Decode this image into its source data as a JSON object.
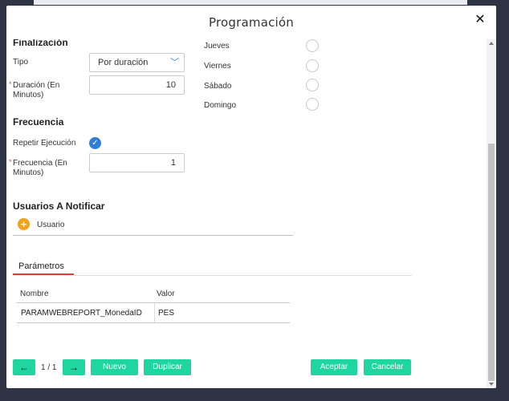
{
  "dialog": {
    "title": "Programación",
    "close_icon": "close-icon"
  },
  "finalizacion": {
    "section_title": "Finalización",
    "tipo_label": "Tipo",
    "tipo_value": "Por duración",
    "duracion_label_line1": "Duración (En",
    "duracion_label_line2": "Minutos)",
    "duracion_value": "10",
    "required_mark": "*"
  },
  "dias": [
    {
      "label": "Jueves"
    },
    {
      "label": "Viernes"
    },
    {
      "label": "Sábado"
    },
    {
      "label": "Domingo"
    }
  ],
  "frecuencia": {
    "section_title": "Frecuencia",
    "repetir_label": "Repetir Ejecución",
    "repetir_checked": true,
    "frecuencia_label_line1": "Frecuencia (En",
    "frecuencia_label_line2": "Minutos)",
    "frecuencia_value": "1",
    "required_mark": "*"
  },
  "usuarios": {
    "section_title": "Usuarios A Notificar",
    "add_label": "Usuario"
  },
  "parametros": {
    "tab_label": "Parámetros",
    "columns": [
      "Nombre",
      "Valor"
    ],
    "rows": [
      {
        "nombre": "PARAMWEBREPORT_MonedaID",
        "valor": "PES"
      }
    ]
  },
  "footer": {
    "prev_icon": "arrow-left-icon",
    "page_indicator": "1 / 1",
    "next_icon": "arrow-right-icon",
    "nuevo_label": "Nuevo",
    "duplicar_label": "Duplicar",
    "aceptar_label": "Aceptar",
    "cancelar_label": "Cancelar"
  },
  "colors": {
    "accent": "#1fd6a0",
    "check": "#2f7fd8",
    "add": "#f2a11b",
    "tab_underline": "#e53935"
  }
}
